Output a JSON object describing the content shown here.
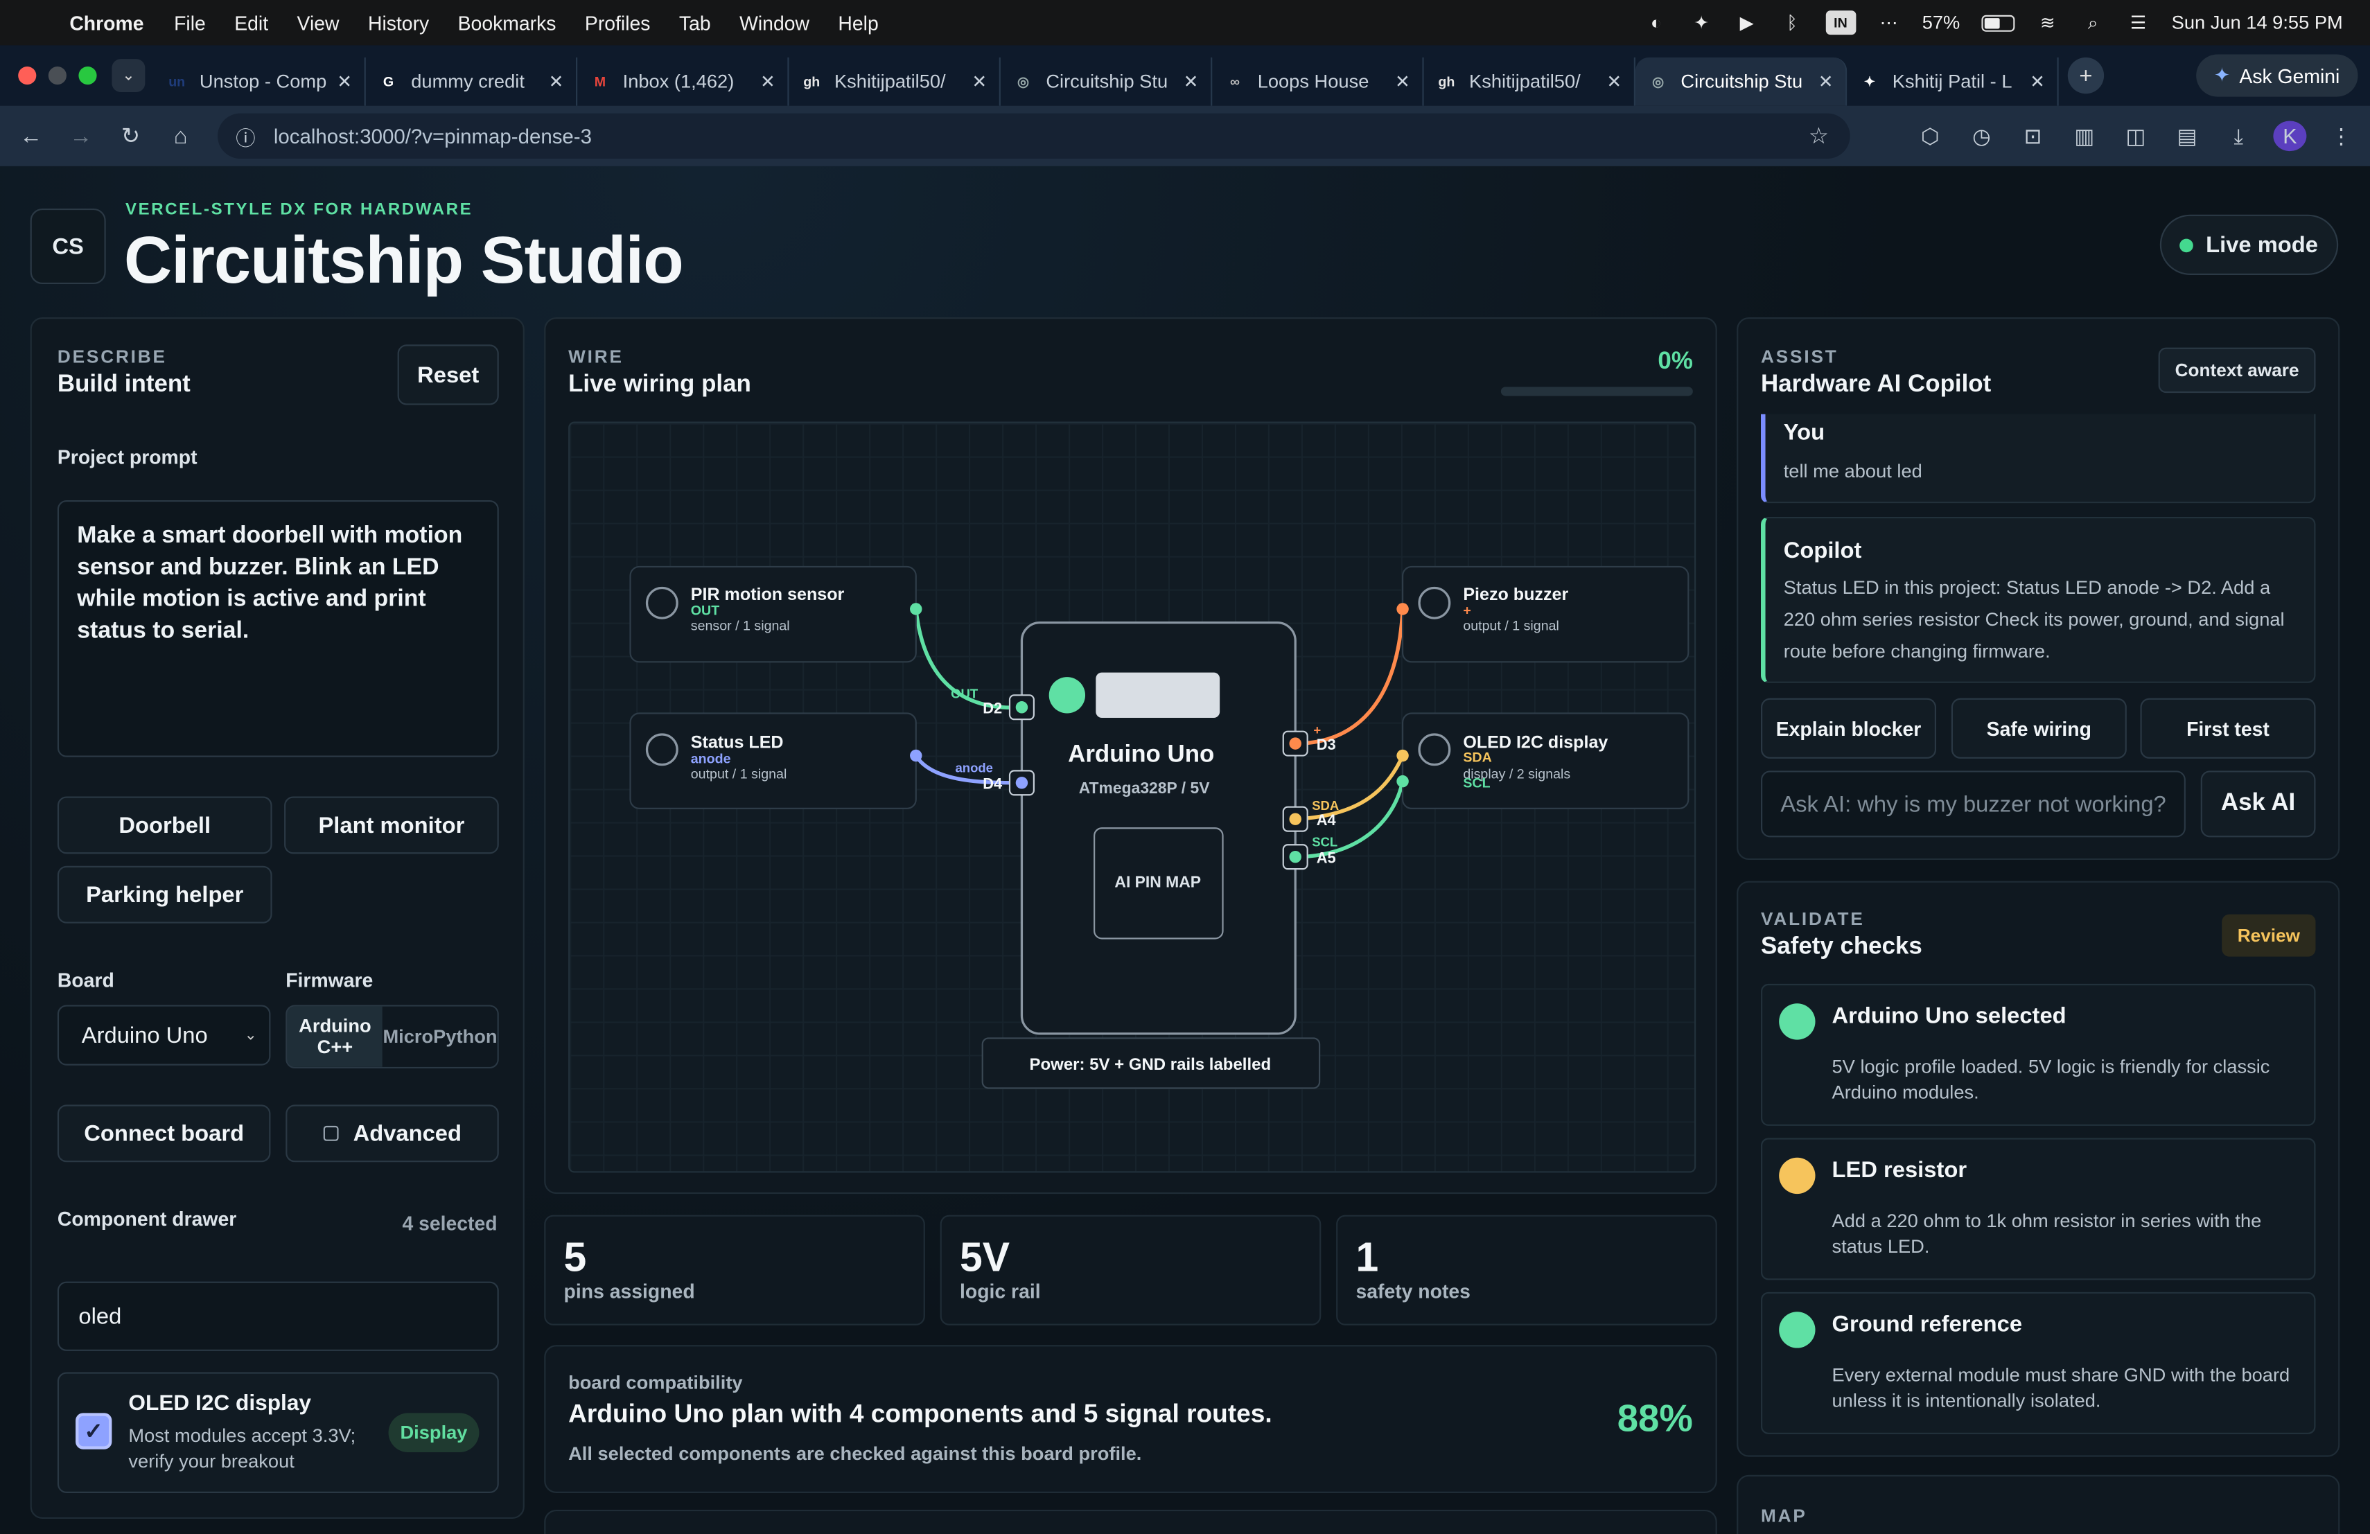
{
  "menubar": {
    "app": "Chrome",
    "items": [
      "File",
      "Edit",
      "View",
      "History",
      "Bookmarks",
      "Profiles",
      "Tab",
      "Window",
      "Help"
    ],
    "battery_pct": "57%",
    "battery_level": 0.57,
    "clock": "Sun Jun 14  9:55 PM"
  },
  "tabs": [
    {
      "title": "Unstop - Comp",
      "fav": "un",
      "fav_color": "#1f3c7a"
    },
    {
      "title": "dummy credit",
      "fav": "G",
      "fav_color": "#ffffff"
    },
    {
      "title": "Inbox (1,462)",
      "fav": "M",
      "fav_color": "#e8453c"
    },
    {
      "title": "Kshitijpatil50/",
      "fav": "gh",
      "fav_color": "#e6e6e6"
    },
    {
      "title": "Circuitship Stu",
      "fav": "◎",
      "fav_color": "#9aa"
    },
    {
      "title": "Loops House",
      "fav": "∞",
      "fav_color": "#bbb"
    },
    {
      "title": "Kshitijpatil50/",
      "fav": "gh",
      "fav_color": "#e6e6e6"
    },
    {
      "title": "Circuitship Stu",
      "fav": "◎",
      "fav_color": "#9aa"
    },
    {
      "title": "Kshitij Patil - L",
      "fav": "✦",
      "fav_color": "#fff"
    }
  ],
  "gemini_label": "Ask Gemini",
  "url": "localhost:3000/?v=pinmap-dense-3",
  "profile_initial": "K",
  "header": {
    "logo": "CS",
    "eyebrow": "VERCEL-STYLE DX FOR HARDWARE",
    "title": "Circuitship Studio",
    "live_mode": "Live mode"
  },
  "describe": {
    "kicker": "DESCRIBE",
    "title": "Build intent",
    "reset": "Reset",
    "prompt_label": "Project prompt",
    "prompt": "Make a smart doorbell with motion sensor and buzzer. Blink an LED while motion is active and print status to serial.",
    "presets": [
      "Doorbell",
      "Plant monitor",
      "Parking helper"
    ],
    "board_label": "Board",
    "board_value": "Arduino Uno",
    "firmware_label": "Firmware",
    "firmware_options": [
      "Arduino C++",
      "MicroPython"
    ],
    "connect": "Connect board",
    "advanced": "Advanced",
    "drawer_label": "Component drawer",
    "drawer_count": "4 selected",
    "search_value": "oled",
    "component": {
      "name": "OLED I2C display",
      "desc": "Most modules accept 3.3V; verify your breakout",
      "tag": "Display"
    }
  },
  "wire": {
    "kicker": "WIRE",
    "title": "Live wiring plan",
    "progress_label": "0%",
    "progress": 0,
    "board": {
      "name": "Arduino Uno",
      "sub": "ATmega328P / 5V",
      "map": "AI PIN MAP"
    },
    "power": "Power: 5V + GND rails labelled",
    "components": [
      {
        "name": "PIR motion sensor",
        "pin": "OUT",
        "meta": "sensor / 1 signal"
      },
      {
        "name": "Status LED",
        "pin": "anode",
        "meta": "output / 1 signal"
      },
      {
        "name": "Piezo buzzer",
        "pin": "+",
        "meta": "output / 1 signal"
      },
      {
        "name": "OLED I2C display",
        "pin": "SDA",
        "pin2": "SCL",
        "meta": "display / 2 signals"
      }
    ],
    "board_pins": [
      "D2",
      "D4",
      "D3",
      "A4",
      "A5"
    ],
    "wire_labels": [
      "OUT",
      "anode",
      "+",
      "SDA",
      "SCL"
    ],
    "colors": {
      "green": "#5fe0a4",
      "blue": "#8ea2ff",
      "orange": "#ff8a4c",
      "yellow": "#f6c45c"
    }
  },
  "stats": [
    {
      "value": "5",
      "label": "pins assigned"
    },
    {
      "value": "5V",
      "label": "logic rail"
    },
    {
      "value": "1",
      "label": "safety notes"
    }
  ],
  "compat": {
    "kicker": "board compatibility",
    "title": "Arduino Uno plan with 4 components and 5 signal routes.",
    "sub": "All selected components are checked against this board profile.",
    "pct": "88%"
  },
  "assist": {
    "kicker": "ASSIST",
    "title": "Hardware AI Copilot",
    "badge": "Context aware",
    "user_who": "You",
    "user_msg": "tell me about led",
    "bot_who": "Copilot",
    "bot_msg": "Status LED in this project: Status LED anode -> D2. Add a 220 ohm series resistor Check its power, ground, and signal route before changing firmware.",
    "quick": [
      "Explain blocker",
      "Safe wiring",
      "First test"
    ],
    "placeholder": "Ask AI: why is my buzzer not working?",
    "ask": "Ask AI"
  },
  "validate": {
    "kicker": "VALIDATE",
    "title": "Safety checks",
    "badge": "Review",
    "checks": [
      {
        "title": "Arduino Uno selected",
        "desc": "5V logic profile loaded. 5V logic is friendly for classic Arduino modules.",
        "color": "#5fe0a4"
      },
      {
        "title": "LED resistor",
        "desc": "Add a 220 ohm to 1k ohm resistor in series with the status LED.",
        "color": "#f6c45c"
      },
      {
        "title": "Ground reference",
        "desc": "Every external module must share GND with the board unless it is intentionally isolated.",
        "color": "#5fe0a4"
      }
    ]
  },
  "map": {
    "kicker": "MAP"
  }
}
